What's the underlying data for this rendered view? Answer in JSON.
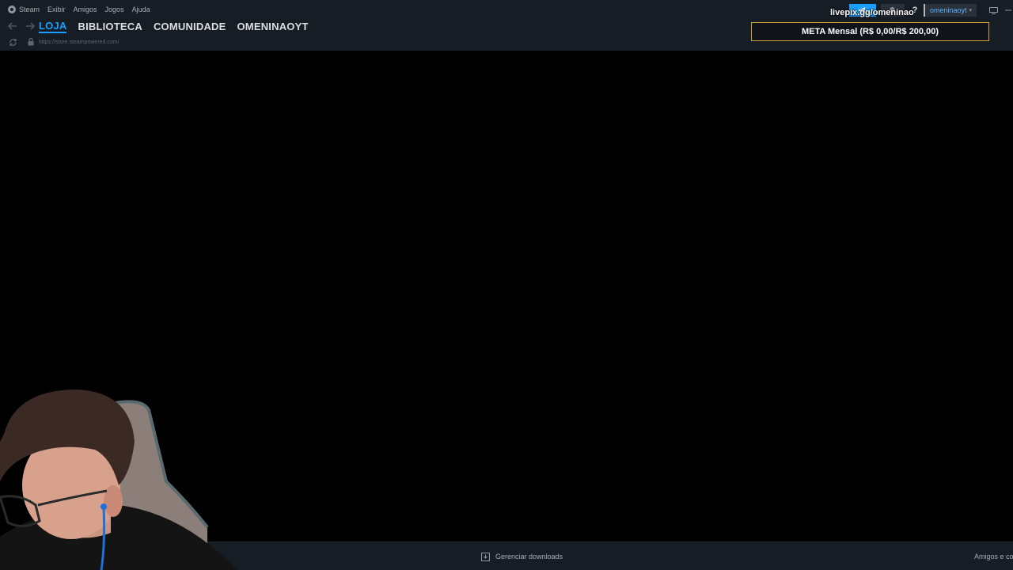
{
  "menubar": {
    "items": [
      "Steam",
      "Exibir",
      "Amigos",
      "Jogos",
      "Ajuda"
    ]
  },
  "nav": {
    "tabs": [
      "LOJA",
      "BIBLIOTECA",
      "COMUNIDADE",
      "OMENINAOYT"
    ],
    "active_tab": "LOJA"
  },
  "address": {
    "url": "https://store.steampowered.com/"
  },
  "top_right": {
    "help_label": "?",
    "username": "omeninaoyt"
  },
  "overlay": {
    "livepix": "livepix.gg/omeninao",
    "meta": "META Mensal (R$ 0,00/R$ 200,00)"
  },
  "bottom_bar": {
    "downloads_label": "Gerenciar downloads",
    "friends_label": "Amigos e co"
  },
  "colors": {
    "header_bg": "#171d25",
    "accent": "#1a9fff",
    "meta_border": "#d2a62e"
  }
}
